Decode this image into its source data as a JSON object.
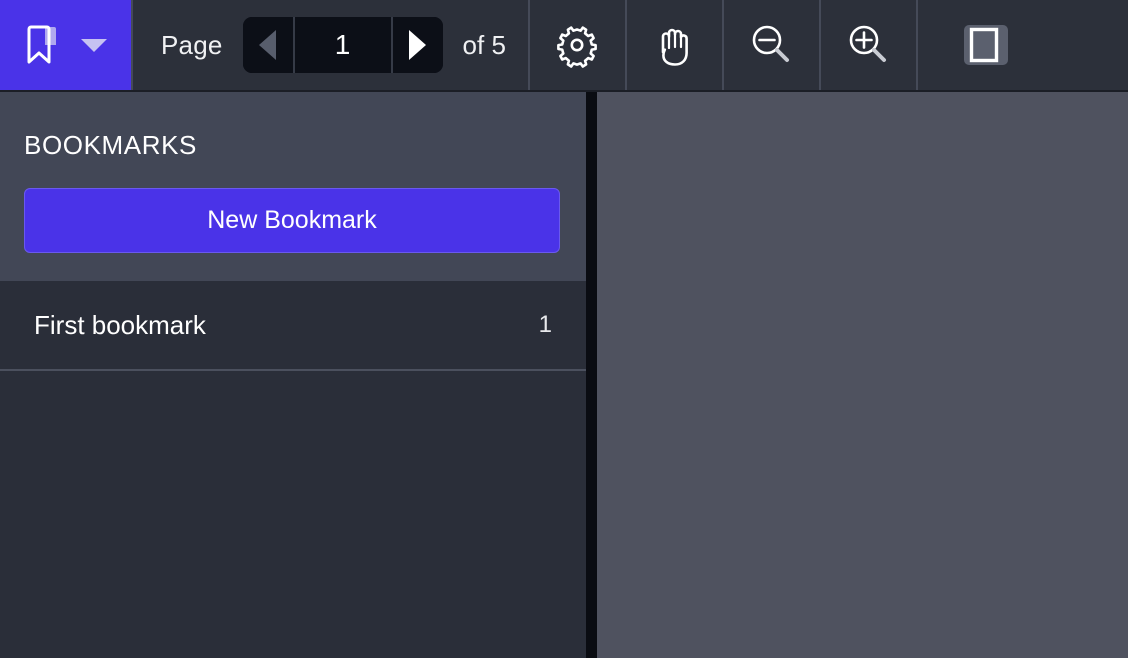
{
  "colors": {
    "accent": "#4a33e8",
    "toolbar_bg": "#2c303a",
    "sidebar_header_bg": "#424756",
    "sidebar_bg": "#2a2e39",
    "content_bg": "#4f525f",
    "field_bg": "#0c0f17",
    "caret": "#c6c2f2"
  },
  "toolbar": {
    "bookmark_toggle": {
      "icon": "bookmark-icon",
      "dropdown_icon": "chevron-down-icon"
    },
    "page": {
      "label": "Page",
      "prev_icon": "triangle-left-icon",
      "next_icon": "triangle-right-icon",
      "current_page": "1",
      "page_placeholder": "1",
      "of_text": "of 5",
      "total_pages": 5
    },
    "buttons": [
      {
        "name": "settings-button",
        "icon": "gear-icon"
      },
      {
        "name": "pan-button",
        "icon": "hand-icon"
      },
      {
        "name": "zoom-out-button",
        "icon": "magnifier-minus-icon"
      },
      {
        "name": "zoom-in-button",
        "icon": "magnifier-plus-icon"
      },
      {
        "name": "sidebar-toggle-button",
        "icon": "panel-layout-icon"
      }
    ]
  },
  "sidebar": {
    "title": "BOOKMARKS",
    "new_bookmark_label": "New Bookmark",
    "bookmarks": [
      {
        "name": "First bookmark",
        "page": "1"
      }
    ]
  },
  "content": {
    "document_area": ""
  }
}
